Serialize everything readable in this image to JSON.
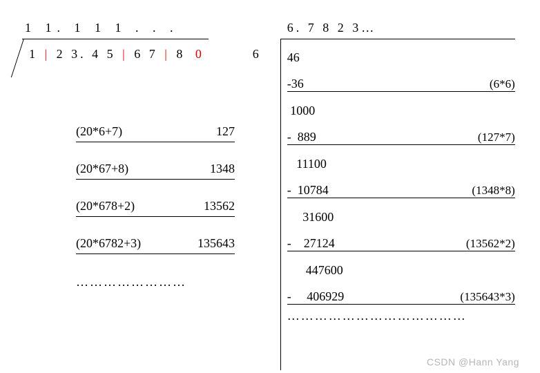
{
  "left": {
    "quotient": "1   1.   1   1   1 . . .",
    "radicand_parts": [
      "1",
      "2  3. 4  5",
      "6  7",
      "8",
      "0"
    ],
    "steps": [
      {
        "expr": "(20*6+7)",
        "val": "127"
      },
      {
        "expr": "(20*67+8)",
        "val": "1348"
      },
      {
        "expr": "(20*678+2)",
        "val": "13562"
      },
      {
        "expr": "(20*6782+3)",
        "val": "135643"
      }
    ],
    "dots": "……………………"
  },
  "right": {
    "quotient": "6.   7  8  2  3…",
    "divisor": "6",
    "rows": [
      {
        "num": "46",
        "note": "",
        "ul": false
      },
      {
        "num": "-36",
        "note": "(6*6)",
        "ul": true
      },
      {
        "num": " 1000",
        "note": "",
        "ul": false
      },
      {
        "num": "-  889",
        "note": "(127*7)",
        "ul": true
      },
      {
        "num": "   11100",
        "note": "",
        "ul": false
      },
      {
        "num": "-  10784",
        "note": "(1348*8)",
        "ul": true
      },
      {
        "num": "     31600",
        "note": "",
        "ul": false
      },
      {
        "num": "-    27124",
        "note": "(13562*2)",
        "ul": true
      },
      {
        "num": "      447600",
        "note": "",
        "ul": false
      },
      {
        "num": "-     406929",
        "note": "(135643*3)",
        "ul": true
      }
    ],
    "dots": "…………………………………"
  },
  "watermark": "CSDN @Hann Yang"
}
